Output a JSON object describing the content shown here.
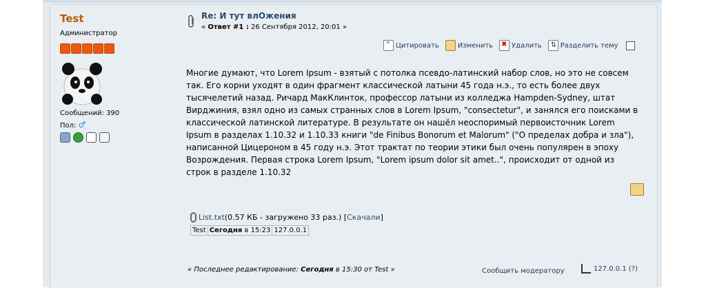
{
  "poster": {
    "name": "Test",
    "role": "Администратор",
    "post_count_label": "Сообщений: 390",
    "gender_label": "Пол:",
    "gender_symbol": "♂"
  },
  "post": {
    "subject": "Re: И тут влОжения",
    "reply_prefix": "«",
    "reply_label": "Ответ #1 :",
    "date": "26 Сентября 2012, 20:01",
    "reply_suffix": "»",
    "body": "Многие думают, что Lorem Ipsum - взятый с потолка псевдо-латинский набор слов, но это не совсем так. Его корни уходят в один фрагмент классической латыни 45 года н.э., то есть более двух тысячелетий назад. Ричард МакКлинток, профессор латыни из колледжа Hampden-Sydney, штат Вирджиния, взял одно из самых странных слов в Lorem Ipsum, \"consectetur\", и занялся его поисками в классической латинской литературе. В результате он нашёл неоспоримый первоисточник Lorem Ipsum в разделах 1.10.32 и 1.10.33 книги \"de Finibus Bonorum et Malorum\" (\"О пределах добра и зла\"), написанной Цицероном в 45 году н.э. Этот трактат по теории этики был очень популярен в эпоху Возрождения. Первая строка Lorem Ipsum, \"Lorem ipsum dolor sit amet..\", происходит от одной из строк в разделе 1.10.32"
  },
  "actions": {
    "quote": "Цитировать",
    "edit": "Изменить",
    "delete": "Удалить",
    "split": "Разделить тему"
  },
  "attachment": {
    "filename": "List.txt",
    "info": " (0.57 КБ - загружено 33 раз.) [",
    "download": "Скачали",
    "close": "]"
  },
  "log": {
    "user": "Test",
    "day": "Сегодня",
    "time": " в 15:23",
    "ip": "127.0.0.1"
  },
  "footer": {
    "last_edit_prefix": "« Последнее редактирование: ",
    "last_edit_day": "Сегодня",
    "last_edit_rest": " в 15:30 от Test »",
    "report": "Сообщить модератору",
    "ip": "127.0.0.1 (?)"
  }
}
